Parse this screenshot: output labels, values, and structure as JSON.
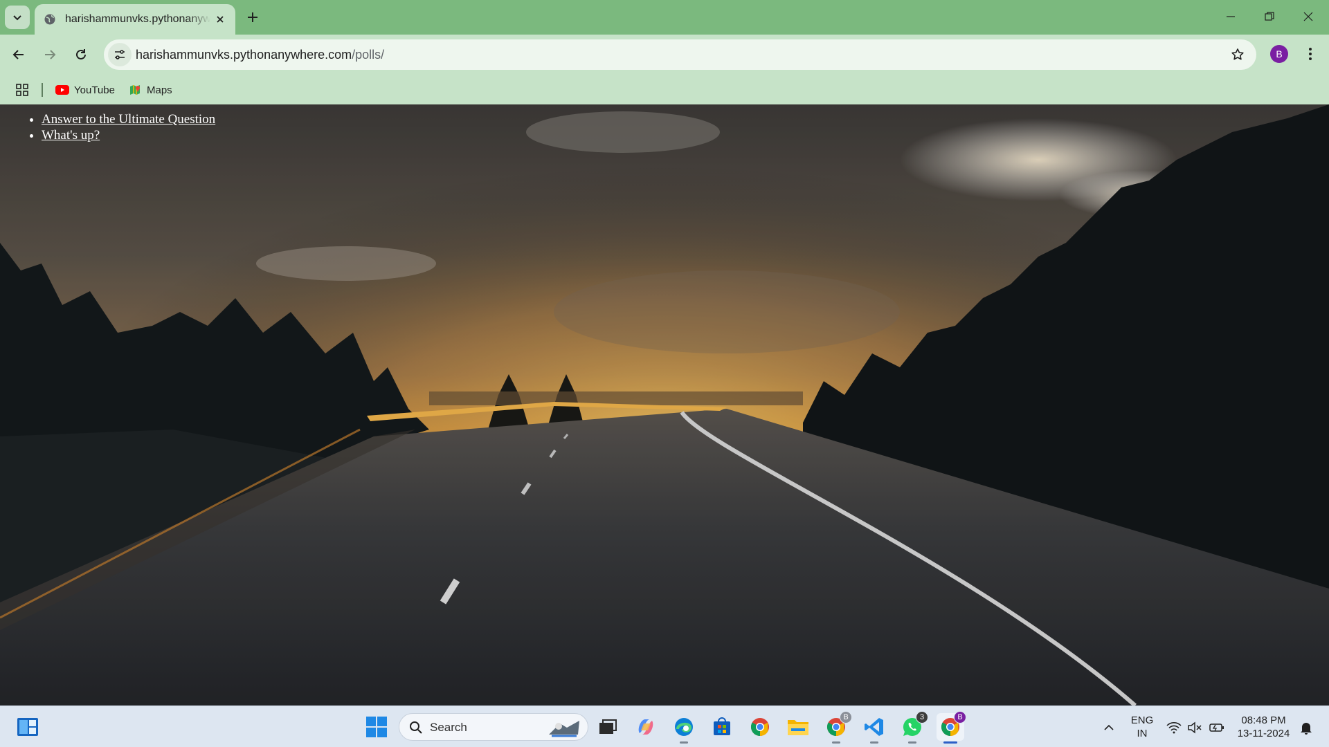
{
  "browser": {
    "tab": {
      "title": "harishammunvks.pythonanywhere.com/polls/",
      "favicon": "globe-icon"
    },
    "address_bar": {
      "domain": "harishammunvks.pythonanywhere.com",
      "path": "/polls/"
    },
    "profile_initial": "B",
    "bookmarks": [
      {
        "label": "YouTube",
        "icon": "youtube-icon"
      },
      {
        "label": "Maps",
        "icon": "maps-icon"
      }
    ],
    "colors": {
      "tabstrip": "#7bb97e",
      "toolbar": "#c6e3c8",
      "profile": "#7a1fa2"
    }
  },
  "page": {
    "background": "sunset-road-photo",
    "polls": [
      {
        "question": "Answer to the Ultimate Question"
      },
      {
        "question": "What's up?"
      }
    ]
  },
  "taskbar": {
    "search_label": "Search",
    "apps": [
      "start-icon",
      "widgets-icon",
      "task-view-icon",
      "copilot-icon",
      "edge-icon",
      "store-icon",
      "chrome-icon",
      "file-explorer-icon",
      "chrome-profile-icon",
      "vscode-icon",
      "whatsapp-icon",
      "chrome-active-icon"
    ],
    "whatsapp_badge": "3",
    "chrome_profile_badge": "B",
    "chrome_active_badge": "B",
    "tray": {
      "language_line1": "ENG",
      "language_line2": "IN",
      "time": "08:48 PM",
      "date": "13-11-2024"
    }
  }
}
